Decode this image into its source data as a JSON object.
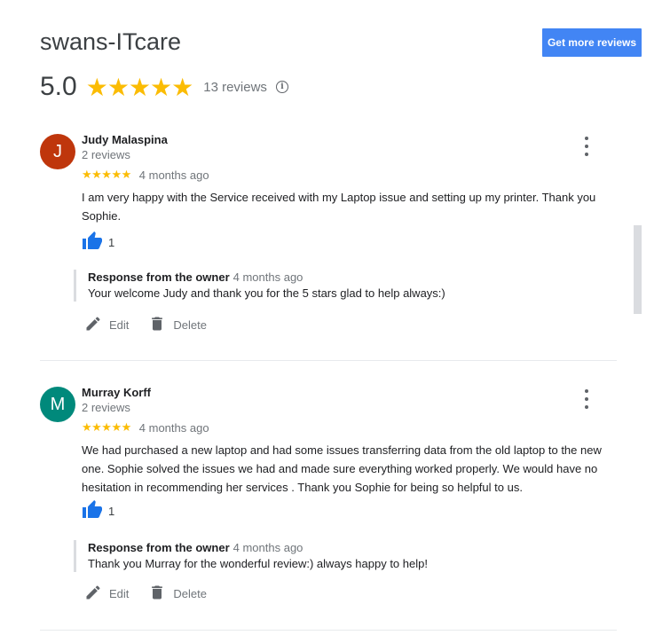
{
  "header": {
    "business_name": "swans-ITcare",
    "get_more_reviews_label": "Get more reviews",
    "rating": "5.0",
    "stars": "★★★★★",
    "review_count": "13 reviews",
    "info_symbol": "i"
  },
  "colors": {
    "accent_blue": "#4285f4",
    "star_yellow": "#fbbc04",
    "thumb_blue": "#1a73e8"
  },
  "reviews": [
    {
      "avatar_letter": "J",
      "avatar_color": "#bf360c",
      "name": "Judy Malaspina",
      "review_count": "2 reviews",
      "stars": "★★★★★",
      "time": "4 months ago",
      "text": "I am very happy with the Service received with my Laptop issue and setting up my printer. Thank you Sophie.",
      "likes": "1",
      "response_label": "Response from the owner",
      "response_time": "4 months ago",
      "response_text": "Your welcome Judy and thank you for the 5 stars glad to help always:)",
      "edit_label": "Edit",
      "delete_label": "Delete",
      "icons": [
        "thumb-up-icon",
        "pencil-icon",
        "trash-icon",
        "more-vert-icon"
      ]
    },
    {
      "avatar_letter": "M",
      "avatar_color": "#00897b",
      "name": "Murray Korff",
      "review_count": "2 reviews",
      "stars": "★★★★★",
      "time": "4 months ago",
      "text": "We had purchased a new laptop and had some issues transferring data from the old laptop to the new one. Sophie solved the issues  we had and made sure everything worked properly. We would have no hesitation in recommending her services . Thank you Sophie for being so helpful to us.",
      "likes": "1",
      "response_label": "Response from the owner",
      "response_time": "4 months ago",
      "response_text": "Thank you Murray for the wonderful review:) always happy to help!",
      "edit_label": "Edit",
      "delete_label": "Delete",
      "icons": [
        "thumb-up-icon",
        "pencil-icon",
        "trash-icon",
        "more-vert-icon"
      ]
    }
  ]
}
